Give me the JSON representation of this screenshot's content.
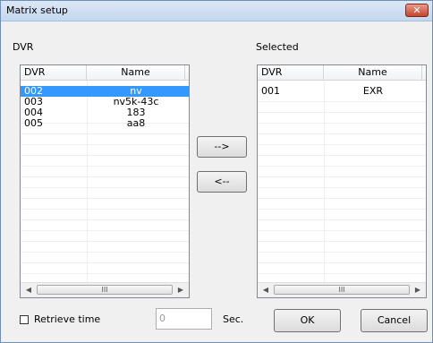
{
  "window": {
    "title": "Matrix setup",
    "close_glyph": "✕"
  },
  "left_panel": {
    "label": "DVR",
    "columns": [
      "DVR",
      "Name"
    ],
    "rows": [
      {
        "dvr": "002",
        "name": "nv",
        "selected": true
      },
      {
        "dvr": "003",
        "name": "nv5k-43c",
        "selected": false
      },
      {
        "dvr": "004",
        "name": "183",
        "selected": false
      },
      {
        "dvr": "005",
        "name": "aa8",
        "selected": false
      }
    ]
  },
  "right_panel": {
    "label": "Selected",
    "columns": [
      "DVR",
      "Name"
    ],
    "rows": [
      {
        "dvr": "001",
        "name": "EXR",
        "selected": false
      }
    ]
  },
  "buttons": {
    "add": "-->",
    "remove": "<--",
    "ok": "OK",
    "cancel": "Cancel"
  },
  "retrieve": {
    "label": "Retrieve time",
    "value": "0",
    "unit": "Sec."
  },
  "scroll_glyphs": {
    "left": "◀",
    "right": "▶",
    "grip": "III"
  },
  "colors": {
    "selection": "#3399ff",
    "close": "#c4452d"
  }
}
